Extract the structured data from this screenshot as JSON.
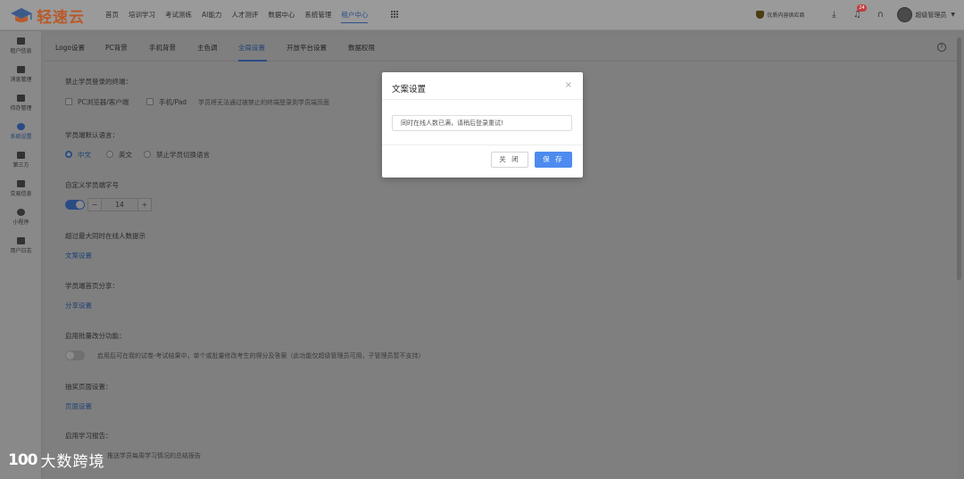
{
  "header": {
    "logo_text": "轻速云",
    "nav": [
      "首页",
      "培训学习",
      "考试测练",
      "AI能力",
      "人才测评",
      "数据中心",
      "系统管理",
      "租户中心"
    ],
    "active_nav": "租户中心",
    "promo": "优质内容供应商",
    "notification_count": "24",
    "user_name": "超级管理员"
  },
  "sidebar": {
    "items": [
      {
        "label": "租户信息",
        "icon": "building-icon"
      },
      {
        "label": "消息管理",
        "icon": "message-icon"
      },
      {
        "label": "待办管理",
        "icon": "todo-icon"
      },
      {
        "label": "系统设置",
        "icon": "settings-icon"
      },
      {
        "label": "第三方",
        "icon": "third-party-icon"
      },
      {
        "label": "交易信息",
        "icon": "transaction-icon"
      },
      {
        "label": "小程序",
        "icon": "mini-program-icon"
      },
      {
        "label": "用户日志",
        "icon": "log-icon"
      }
    ],
    "active": "系统设置"
  },
  "tabs": {
    "items": [
      "Logo设置",
      "PC背景",
      "手机背景",
      "主色调",
      "全局设置",
      "开放平台设置",
      "数据权限"
    ],
    "active": "全局设置"
  },
  "settings": {
    "login_terminal": {
      "label": "禁止学员登录的终端：",
      "options": [
        "PC浏览器/客户端",
        "手机/Pad"
      ],
      "hint": "学员将无法通过被禁止的终端登录到学员端页面"
    },
    "default_language": {
      "label": "学员端默认语言：",
      "options": [
        "中文",
        "英文",
        "禁止学员切换语言"
      ],
      "selected": "中文"
    },
    "font_size": {
      "label": "自定义学员端字号",
      "enabled": true,
      "value": "14",
      "minus": "−",
      "plus": "+"
    },
    "online_limit": {
      "label": "超过最大同时在线人数提示",
      "link": "文案设置"
    },
    "home_share": {
      "label": "学员端首页分享：",
      "link": "分享设置"
    },
    "batch_grading": {
      "label": "启用批量改分功能：",
      "enabled": false,
      "hint": "启用后可在我的试卷-考试结果中，单个或批量修改考生的得分及答案（此功能仅超级管理员可用，子管理员暂不支持）"
    },
    "lottery_page": {
      "label": "抽奖页面设置：",
      "link": "页面设置"
    },
    "study_report": {
      "label": "启用学习报告：",
      "hint": "推送学员每周学习情况的总结报告"
    }
  },
  "modal": {
    "title": "文案设置",
    "close_glyph": "×",
    "input_value": "同时在线人数已满，请稍后登录重试!",
    "cancel_label": "关 闭",
    "save_label": "保 存"
  },
  "watermark": {
    "mark": "100",
    "text": "大数跨境"
  },
  "colors": {
    "primary": "#4d8bee",
    "overlay": "#7f7f7f",
    "logo": "#e4783c"
  }
}
